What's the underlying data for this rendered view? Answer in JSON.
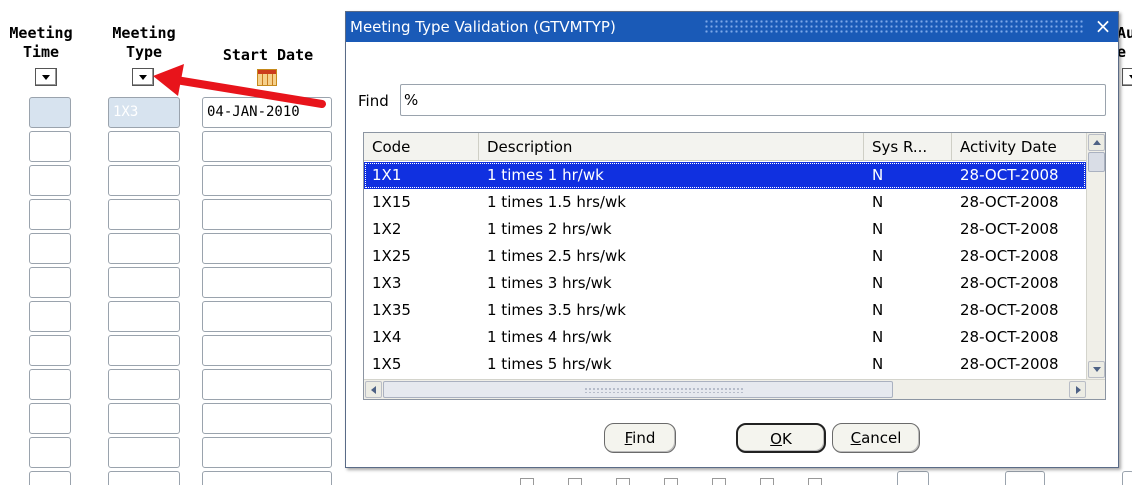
{
  "form": {
    "columns": [
      {
        "label": "Meeting\nTime"
      },
      {
        "label": "Meeting\nType"
      },
      {
        "label": "Start Date"
      }
    ],
    "first_row": {
      "meeting_type": "1X3",
      "start_date": "04-JAN-2010"
    },
    "partial_heading": "Au\ne"
  },
  "dialog": {
    "title": "Meeting Type Validation (GTVMTYP)",
    "close_glyph": "×",
    "find_label": "Find",
    "find_value": "%",
    "columns": [
      "Code",
      "Description",
      "Sys R...",
      "Activity Date"
    ],
    "rows": [
      {
        "code": "1X1",
        "description": "1 times 1 hr/wk",
        "sys": "N",
        "activity_date": "28-OCT-2008",
        "selected": true
      },
      {
        "code": "1X15",
        "description": "1 times 1.5 hrs/wk",
        "sys": "N",
        "activity_date": "28-OCT-2008"
      },
      {
        "code": "1X2",
        "description": "1 times 2 hrs/wk",
        "sys": "N",
        "activity_date": "28-OCT-2008"
      },
      {
        "code": "1X25",
        "description": "1 times 2.5 hrs/wk",
        "sys": "N",
        "activity_date": "28-OCT-2008"
      },
      {
        "code": "1X3",
        "description": "1 times 3 hrs/wk",
        "sys": "N",
        "activity_date": "28-OCT-2008"
      },
      {
        "code": "1X35",
        "description": "1 times 3.5 hrs/wk",
        "sys": "N",
        "activity_date": "28-OCT-2008"
      },
      {
        "code": "1X4",
        "description": "1 times 4 hrs/wk",
        "sys": "N",
        "activity_date": "28-OCT-2008"
      },
      {
        "code": "1X5",
        "description": "1 times 5 hrs/wk",
        "sys": "N",
        "activity_date": "28-OCT-2008"
      }
    ],
    "buttons": {
      "find": {
        "mnemonic": "F",
        "rest": "ind"
      },
      "ok": {
        "mnemonic": "O",
        "rest": "K"
      },
      "cancel": {
        "mnemonic": "C",
        "rest": "ancel"
      }
    }
  },
  "colors": {
    "titlebar": "#1a5ab7",
    "selection": "#1030e0",
    "annotation_arrow": "#e8141b"
  }
}
